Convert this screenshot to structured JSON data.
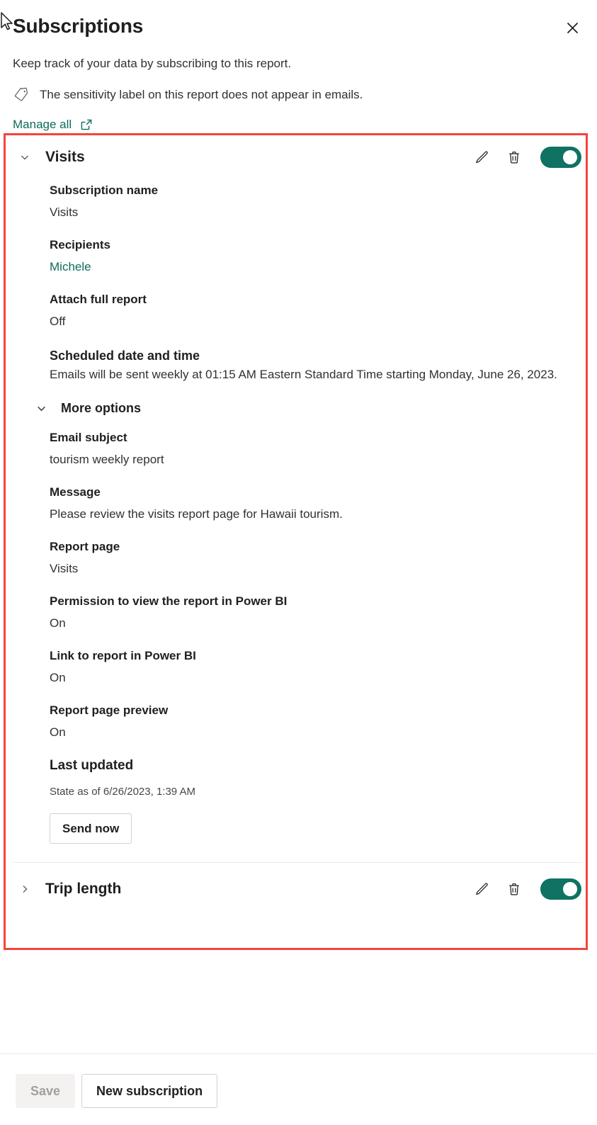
{
  "header": {
    "title": "Subscriptions",
    "close_icon": "close-icon",
    "subtitle": "Keep track of your data by subscribing to this report.",
    "sensitivity_icon": "tag-icon",
    "sensitivity_text": "The sensitivity label on this report does not appear in emails.",
    "manage_all_label": "Manage all",
    "manage_all_icon": "external-link-icon"
  },
  "subscriptions": [
    {
      "name": "Visits",
      "expanded": true,
      "chevron_icon": "chevron-down-icon",
      "edit_icon": "pencil-icon",
      "delete_icon": "trash-icon",
      "toggle_state": "On",
      "fields": {
        "subscription_name_label": "Subscription name",
        "subscription_name_value": "Visits",
        "recipients_label": "Recipients",
        "recipients_value": "Michele",
        "attach_full_report_label": "Attach full report",
        "attach_full_report_value": "Off",
        "scheduled_label": "Scheduled date and time",
        "scheduled_value": "Emails will be sent weekly at 01:15 AM Eastern Standard Time starting Monday, June 26, 2023.",
        "more_options_label": "More options",
        "more_options_icon": "chevron-down-icon",
        "email_subject_label": "Email subject",
        "email_subject_value": "tourism weekly report",
        "message_label": "Message",
        "message_value": "Please review the visits report page for Hawaii tourism.",
        "report_page_label": "Report page",
        "report_page_value": "Visits",
        "permission_label": "Permission to view the report in Power BI",
        "permission_value": "On",
        "link_to_report_label": "Link to report in Power BI",
        "link_to_report_value": "On",
        "page_preview_label": "Report page preview",
        "page_preview_value": "On",
        "last_updated_label": "Last updated",
        "last_updated_value": "State as of 6/26/2023, 1:39 AM",
        "send_now_label": "Send now"
      }
    },
    {
      "name": "Trip length",
      "expanded": false,
      "chevron_icon": "chevron-right-icon",
      "edit_icon": "pencil-icon",
      "delete_icon": "trash-icon",
      "toggle_state": "On"
    }
  ],
  "footer": {
    "save_label": "Save",
    "new_subscription_label": "New subscription"
  },
  "colors": {
    "accent_teal": "#0f7262",
    "link_teal": "#0f6c5d",
    "highlight_red": "#f4443e",
    "text_primary": "#201f1e",
    "text_secondary": "#323130",
    "border": "#d2d0ce",
    "disabled_bg": "#f3f2f1",
    "disabled_text": "#a19f9d"
  }
}
